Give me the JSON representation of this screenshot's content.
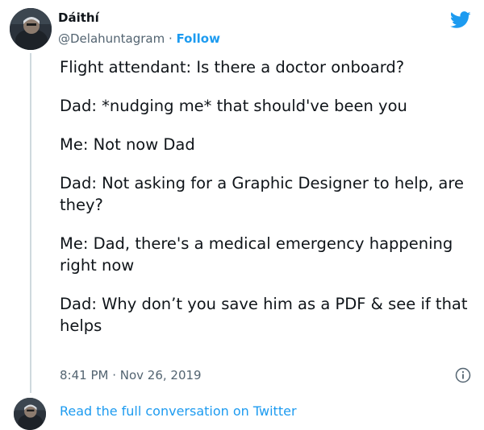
{
  "author": {
    "display_name": "Dáithí",
    "handle": "@Delahuntagram",
    "separator": " · ",
    "follow_label": "Follow"
  },
  "tweet": {
    "lines": [
      "Flight attendant: Is there a doctor onboard?",
      "Dad: *nudging me* that should've been you",
      "Me: Not now Dad",
      "Dad: Not asking for a Graphic Designer to help, are they?",
      "Me: Dad, there's a medical emergency happening right now",
      "Dad: Why don’t you save him as a PDF & see if that helps"
    ],
    "timestamp": "8:41 PM · Nov 26, 2019"
  },
  "footer": {
    "read_more_label": "Read the full conversation on Twitter"
  },
  "colors": {
    "accent": "#1d9bf0",
    "text": "#0f1419",
    "muted": "#536471"
  },
  "icons": {
    "brand": "twitter-bird-icon",
    "info": "info-icon"
  }
}
